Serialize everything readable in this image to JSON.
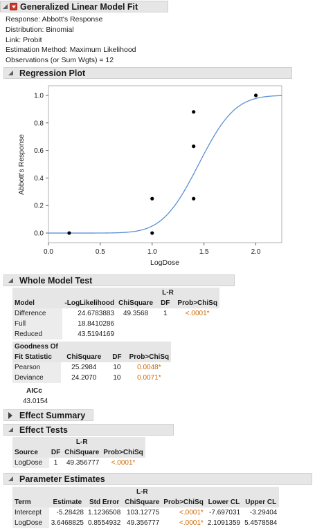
{
  "report": {
    "title": "Generalized Linear Model Fit",
    "info": [
      "Response: Abbott's Response",
      "Distribution: Binomial",
      "Link: Probit",
      "Estimation Method: Maximum Likelihood",
      "Observations (or Sum Wgts) = 12"
    ]
  },
  "regression_plot": {
    "title": "Regression Plot"
  },
  "chart_data": {
    "type": "scatter",
    "xlabel": "LogDose",
    "ylabel": "Abbott's Response",
    "xlim": [
      0.0,
      2.25
    ],
    "ylim": [
      -0.07,
      1.07
    ],
    "xticks": [
      "0.0",
      "0.5",
      "1.0",
      "1.5",
      "2.0"
    ],
    "yticks": [
      "0.0",
      "0.2",
      "0.4",
      "0.6",
      "0.8",
      "1.0"
    ],
    "grid": false,
    "points": [
      {
        "x": 0.2,
        "y": 0.0
      },
      {
        "x": 1.0,
        "y": 0.0
      },
      {
        "x": 1.0,
        "y": 0.25
      },
      {
        "x": 1.4,
        "y": 0.25
      },
      {
        "x": 1.4,
        "y": 0.63
      },
      {
        "x": 1.4,
        "y": 0.88
      },
      {
        "x": 2.0,
        "y": 1.0
      }
    ],
    "fit_curve": {
      "type": "probit",
      "intercept": -5.28428,
      "slope": 3.6468825,
      "color": "#5b8fd6"
    },
    "point_color": "#000000"
  },
  "whole_model_test": {
    "title": "Whole Model Test",
    "lr_header": "L-R",
    "columns": [
      "Model",
      "-LogLikelihood",
      "ChiSquare",
      "DF",
      "Prob>ChiSq"
    ],
    "rows": [
      {
        "label": "Difference",
        "loglik": "24.6783883",
        "chisq": "49.3568",
        "df": "1",
        "prob": "<.0001*"
      },
      {
        "label": "Full",
        "loglik": "18.8410286",
        "chisq": "",
        "df": "",
        "prob": ""
      },
      {
        "label": "Reduced",
        "loglik": "43.5194169",
        "chisq": "",
        "df": "",
        "prob": ""
      }
    ],
    "gof_header_1": "Goodness Of",
    "gof_header_2": "Fit Statistic",
    "gof_columns": [
      "ChiSquare",
      "DF",
      "Prob>ChiSq"
    ],
    "gof_rows": [
      {
        "label": "Pearson",
        "chisq": "25.2984",
        "df": "10",
        "prob": "0.0048*"
      },
      {
        "label": "Deviance",
        "chisq": "24.2070",
        "df": "10",
        "prob": "0.0071*"
      }
    ],
    "aicc_label": "AICc",
    "aicc_value": "43.0154"
  },
  "effect_summary": {
    "title": "Effect Summary"
  },
  "effect_tests": {
    "title": "Effect Tests",
    "lr_header": "L-R",
    "columns": [
      "Source",
      "DF",
      "ChiSquare",
      "Prob>ChiSq"
    ],
    "rows": [
      {
        "source": "LogDose",
        "df": "1",
        "chisq": "49.356777",
        "prob": "<.0001*"
      }
    ]
  },
  "parameter_estimates": {
    "title": "Parameter Estimates",
    "lr_header": "L-R",
    "columns": [
      "Term",
      "Estimate",
      "Std Error",
      "ChiSquare",
      "Prob>ChiSq",
      "Lower CL",
      "Upper CL"
    ],
    "rows": [
      {
        "term": "Intercept",
        "estimate": "-5.28428",
        "stderr": "1.1236508",
        "chisq": "103.12775",
        "prob": "<.0001*",
        "lower": "-7.697031",
        "upper": "-3.29404"
      },
      {
        "term": "LogDose",
        "estimate": "3.6468825",
        "stderr": "0.8554932",
        "chisq": "49.356777",
        "prob": "<.0001*",
        "lower": "2.1091359",
        "upper": "5.4578584"
      }
    ]
  },
  "colors": {
    "accent_prob": "#d06a00",
    "header_bg": "#e6e6e6"
  }
}
